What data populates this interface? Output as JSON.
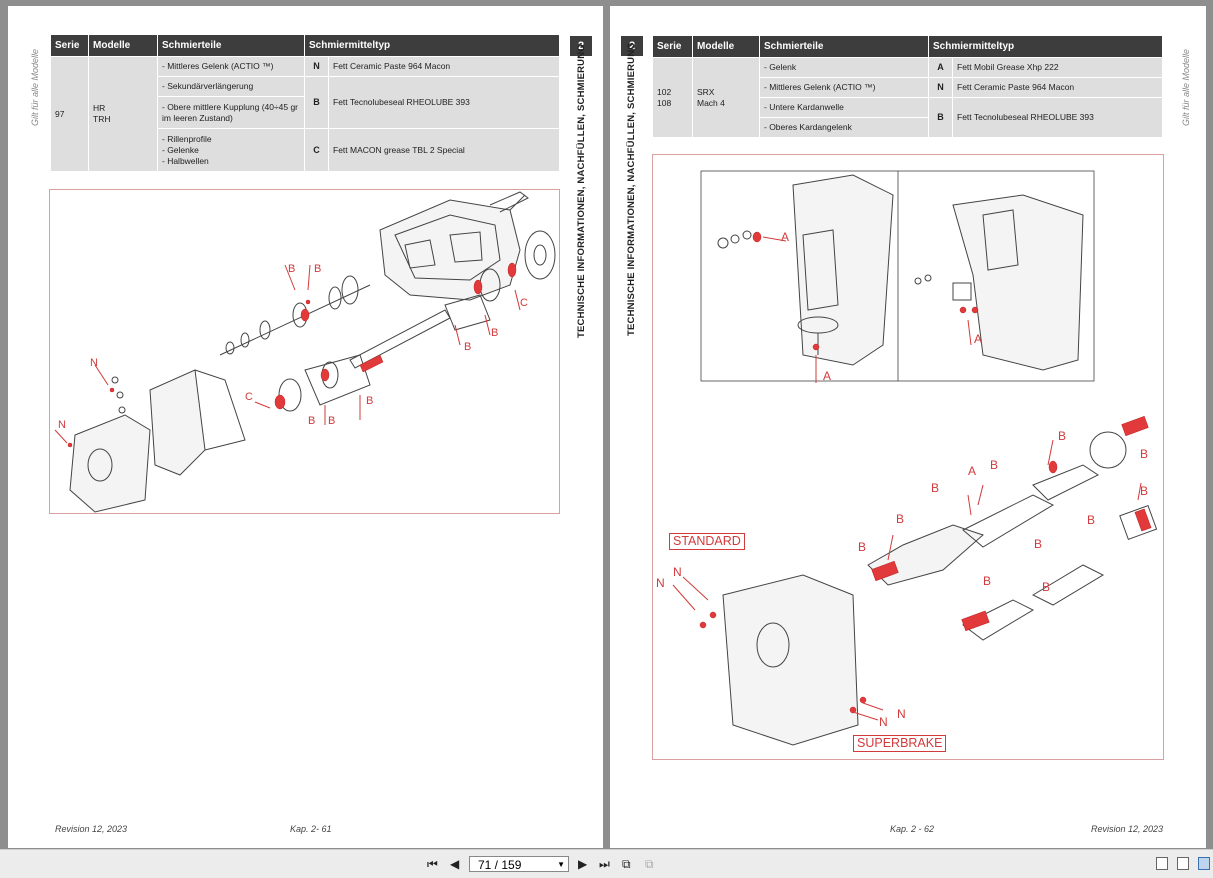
{
  "left_page": {
    "side_note": "Gilt für alle Modelle",
    "chapter_number": "2",
    "chapter_title": "TECHNISCHE INFORMATIONEN, NACHFÜLLEN, SCHMIERUNG",
    "table": {
      "headers": [
        "Serie",
        "Modelle",
        "Schmierteile",
        "Schmiermitteltyp"
      ],
      "serie": "97",
      "models": [
        "HR",
        "TRH"
      ],
      "parts": [
        "- Mittleres Gelenk (ACTIO ™)",
        "- Sekundärverlängerung",
        "- Obere mittlere Kupplung (40÷45 gr im leeren Zustand)",
        "- Rillenprofile",
        "- Gelenke",
        "- Halbwellen"
      ],
      "lubricants": [
        {
          "letter": "N",
          "type": "Fett Ceramic Paste 964 Macon"
        },
        {
          "letter": "B",
          "type": "Fett Tecnolubeseal RHEOLUBE 393"
        },
        {
          "letter": "C",
          "type": "Fett MACON grease TBL 2 Special"
        }
      ]
    },
    "callouts": [
      "B",
      "B",
      "C",
      "B",
      "B",
      "B",
      "N",
      "C",
      "B",
      "B",
      "N"
    ],
    "footer_left": "Revision 12, 2023",
    "footer_page": "Kap. 2- 61"
  },
  "right_page": {
    "side_note": "Gilt für alle Modelle",
    "chapter_number": "2",
    "chapter_title": "TECHNISCHE INFORMATIONEN, NACHFÜLLEN, SCHMIERUNG",
    "table": {
      "headers": [
        "Serie",
        "Modelle",
        "Schmierteile",
        "Schmiermitteltyp"
      ],
      "serie": [
        "102",
        "108"
      ],
      "models": [
        "SRX",
        "Mach 4"
      ],
      "parts": [
        "- Gelenk",
        "- Mittleres Gelenk (ACTIO ™)",
        "- Untere Kardanwelle",
        "- Oberes Kardangelenk"
      ],
      "lubricants": [
        {
          "letter": "A",
          "type": "Fett Mobil Grease Xhp 222"
        },
        {
          "letter": "N",
          "type": "Fett Ceramic Paste 964 Macon"
        },
        {
          "letter": "B",
          "type": "Fett Tecnolubeseal RHEOLUBE 393"
        }
      ]
    },
    "labels": {
      "standard": "STANDARD",
      "superbrake": "SUPERBRAKE"
    },
    "callouts": [
      "A",
      "A",
      "A",
      "B",
      "B",
      "A",
      "B",
      "B",
      "B",
      "B",
      "B",
      "B",
      "B",
      "B",
      "B",
      "N",
      "N",
      "N",
      "N"
    ],
    "footer_page": "Kap. 2 - 62",
    "footer_right": "Revision 12, 2023"
  },
  "toolbar": {
    "page_indicator": "71 / 159",
    "icons": [
      "first-page-icon",
      "previous-page-icon",
      "next-page-icon",
      "last-page-icon",
      "rotate-icon",
      "copy-icon",
      "single-page-view-icon",
      "continuous-view-icon",
      "two-page-view-icon"
    ]
  },
  "colors": {
    "accent_red": "#d23b3b",
    "header_dark": "#3d3d3d",
    "cell_grey": "#dedede",
    "viewer_bg": "#8e8e8e"
  }
}
